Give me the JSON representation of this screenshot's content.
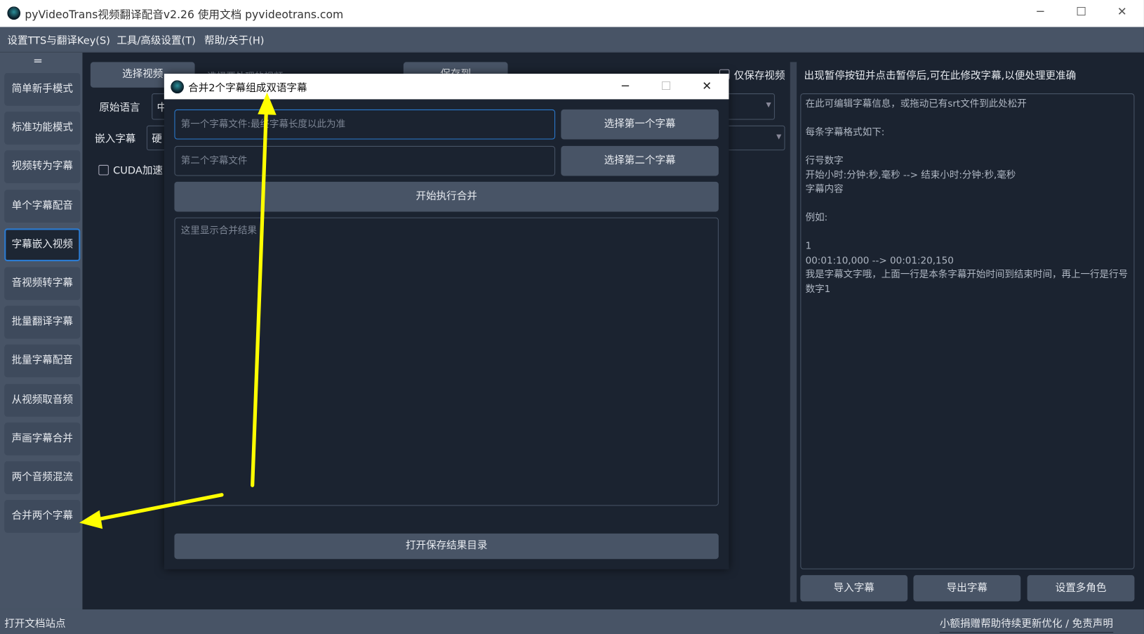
{
  "window": {
    "title": "pyVideoTrans视频翻译配音v2.26  使用文档  pyvideotrans.com"
  },
  "menu": [
    "设置TTS与翻译Key(S)",
    "工具/高级设置(T)",
    "帮助/关于(H)"
  ],
  "sidebar": {
    "toggle": "═",
    "items": [
      "简单新手模式",
      "标准功能模式",
      "视频转为字幕",
      "单个字幕配音",
      "字幕嵌入视频",
      "音视频转字幕",
      "批量翻译字幕",
      "批量字幕配音",
      "从视频取音频",
      "声画字幕合并",
      "两个音频混流",
      "合并两个字幕"
    ],
    "active": 4
  },
  "main": {
    "select_video": "选择视频",
    "select_video_hint": "选择要处理的视频",
    "save_to": "保存到",
    "only_save_video": "仅保存视频",
    "source_lang_label": "原始语言",
    "source_lang_value": "中",
    "embed_sub_label": "嵌入字幕",
    "embed_sub_value": "硬",
    "cuda": "CUDA加速"
  },
  "right": {
    "header": "出现暂停按钮并点击暂停后,可在此修改字幕,以便处理更准确",
    "placeholder": "在此可编辑字幕信息，或拖动已有srt文件到此处松开\n\n每条字幕格式如下:\n\n行号数字\n开始小时:分钟:秒,毫秒 --> 结束小时:分钟:秒,毫秒\n字幕内容\n\n例如:\n\n1\n00:01:10,000 --> 00:01:20,150\n我是字幕文字哦，上面一行是本条字幕开始时间到结束时间，再上一行是行号数字1",
    "import": "导入字幕",
    "export": "导出字幕",
    "roles": "设置多角色"
  },
  "dialog": {
    "title": "合并2个字幕组成双语字幕",
    "first_placeholder": "第一个字幕文件:最终字幕长度以此为准",
    "first_button": "选择第一个字幕",
    "second_placeholder": "第二个字幕文件",
    "second_button": "选择第二个字幕",
    "start": "开始执行合并",
    "result_placeholder": "这里显示合并结果",
    "open_dir": "打开保存结果目录"
  },
  "status": {
    "left": "打开文档站点",
    "right": "小额捐赠帮助待续更新优化 / 免责声明"
  },
  "colors": {
    "accent": "#2b7bd1",
    "panel": "#485466",
    "bg": "#1b2330",
    "annotation": "#ffff00"
  }
}
